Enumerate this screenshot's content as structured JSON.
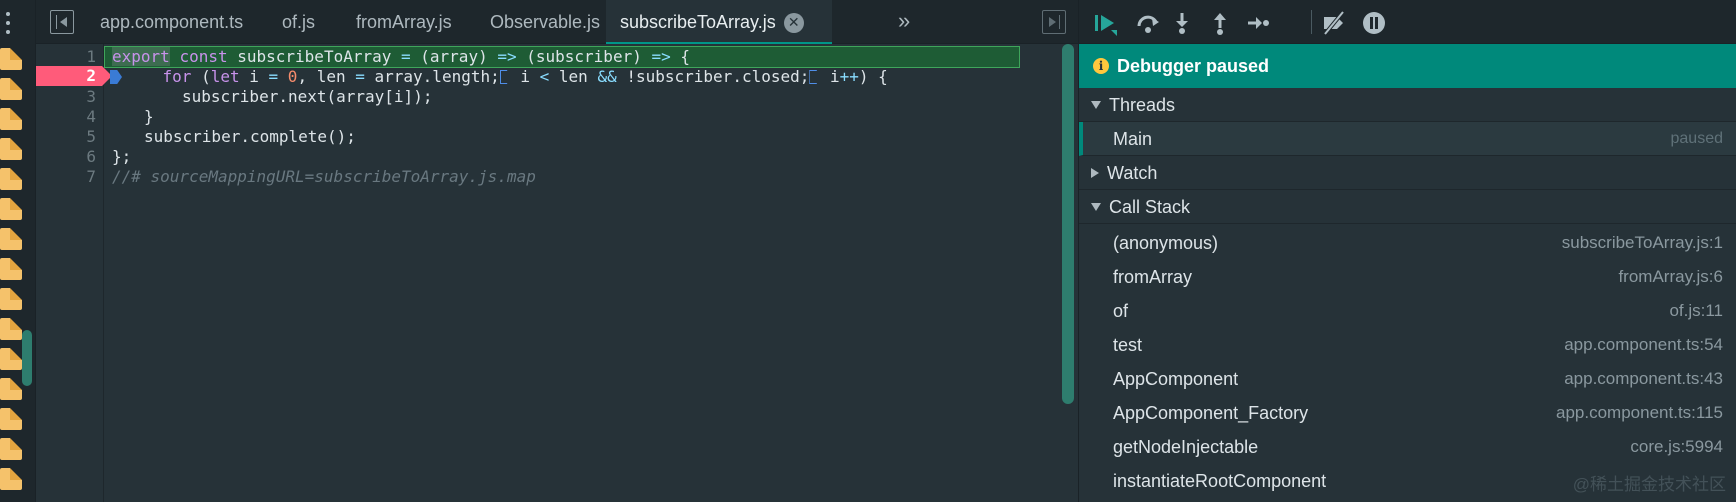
{
  "editor": {
    "tabs": [
      {
        "label": "app.component.ts",
        "active": false
      },
      {
        "label": "of.js",
        "active": false
      },
      {
        "label": "fromArray.js",
        "active": false
      },
      {
        "label": "Observable.js",
        "active": false
      },
      {
        "label": "subscribeToArray.js",
        "active": true
      }
    ],
    "close_glyph": "✕",
    "more_tabs_glyph": "»",
    "line_numbers": [
      "1",
      "2",
      "3",
      "4",
      "5",
      "6",
      "7"
    ],
    "breakpoint_line": "2",
    "code": {
      "l1_kw1": "export",
      "l1_kw2": "const",
      "l1_rest1": " subscribeToArray ",
      "l1_op1": "=",
      "l1_rest2": " (array) ",
      "l1_op2": "=>",
      "l1_rest3": " (subscriber) ",
      "l1_op3": "=>",
      "l1_rest4": " {",
      "l2_kw": "for",
      "l2_a": " (",
      "l2_kw2": "let",
      "l2_b": " i ",
      "l2_eq1": "=",
      "l2_num": "0",
      "l2_c": ", len ",
      "l2_eq2": "=",
      "l2_d": " array.length;",
      "l2_e": " i ",
      "l2_lt": "<",
      "l2_f": " len ",
      "l2_and": "&&",
      "l2_g": " !subscriber.closed;",
      "l2_h": " i",
      "l2_inc": "++",
      "l2_i": ") {",
      "l3": "subscriber.next(array[i]);",
      "l4": "}",
      "l5": "subscriber.complete();",
      "l6": "};",
      "l7": "//# sourceMappingURL=subscribeToArray.js.map"
    }
  },
  "debugger": {
    "banner": "Debugger paused",
    "info_glyph": "i",
    "sections": {
      "threads": "Threads",
      "watch": "Watch",
      "call_stack": "Call Stack"
    },
    "thread": {
      "name": "Main",
      "state": "paused"
    },
    "frames": [
      {
        "fn": "(anonymous)",
        "loc": "subscribeToArray.js:1"
      },
      {
        "fn": "fromArray",
        "loc": "fromArray.js:6"
      },
      {
        "fn": "of",
        "loc": "of.js:11"
      },
      {
        "fn": "test",
        "loc": "app.component.ts:54"
      },
      {
        "fn": "AppComponent",
        "loc": "app.component.ts:43"
      },
      {
        "fn": "AppComponent_Factory",
        "loc": "app.component.ts:115"
      },
      {
        "fn": "getNodeInjectable",
        "loc": "core.js:5994"
      },
      {
        "fn": "instantiateRootComponent",
        "loc": ""
      }
    ],
    "watermark": "@稀土掘金技术社区"
  },
  "colors": {
    "accent": "#00897b",
    "breakpoint": "#ff5b7a",
    "current_line": "#1e5c35",
    "file_icon": "#f5c26b"
  },
  "icons": [
    "continue-icon",
    "step-over-icon",
    "step-into-icon",
    "step-out-icon",
    "step-icon",
    "deactivate-breakpoints-icon",
    "pause-on-exceptions-icon"
  ]
}
